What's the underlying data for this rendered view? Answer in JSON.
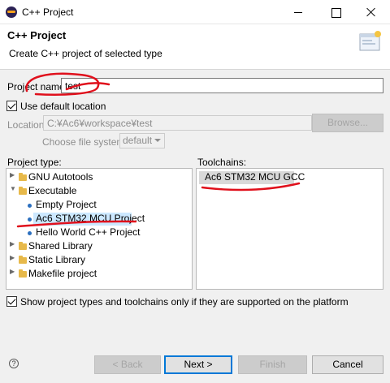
{
  "window": {
    "title": "C++ Project"
  },
  "header": {
    "title": "C++ Project",
    "description": "Create C++ project of selected type"
  },
  "project_name": {
    "label": "Project name:",
    "value": "test"
  },
  "default_location": {
    "label": "Use default location",
    "checked": true
  },
  "location": {
    "label": "Location:",
    "value": "C:¥Ac6¥workspace¥test",
    "browse_label": "Browse..."
  },
  "file_system": {
    "label": "Choose file system:",
    "value": "default"
  },
  "project_type": {
    "label": "Project type:",
    "items": [
      {
        "label": "GNU Autotools",
        "kind": "folder",
        "expanded": false
      },
      {
        "label": "Executable",
        "kind": "folder",
        "expanded": true
      },
      {
        "label": "Empty Project",
        "kind": "item"
      },
      {
        "label": "Ac6 STM32 MCU Project",
        "kind": "item",
        "selected": true
      },
      {
        "label": "Hello World C++ Project",
        "kind": "item"
      },
      {
        "label": "Shared Library",
        "kind": "folder",
        "expanded": false
      },
      {
        "label": "Static Library",
        "kind": "folder",
        "expanded": false
      },
      {
        "label": "Makefile project",
        "kind": "folder",
        "expanded": false
      }
    ]
  },
  "toolchains": {
    "label": "Toolchains:",
    "items": [
      {
        "label": "Ac6 STM32 MCU GCC",
        "selected": true
      }
    ]
  },
  "show_supported": {
    "label": "Show project types and toolchains only if they are supported on the platform",
    "checked": true
  },
  "buttons": {
    "help": "?",
    "back": "< Back",
    "next": "Next >",
    "finish": "Finish",
    "cancel": "Cancel"
  },
  "colors": {
    "selection": "#cce8ff",
    "annotation_ink": "#e0101c",
    "accent": "#0078d7"
  }
}
